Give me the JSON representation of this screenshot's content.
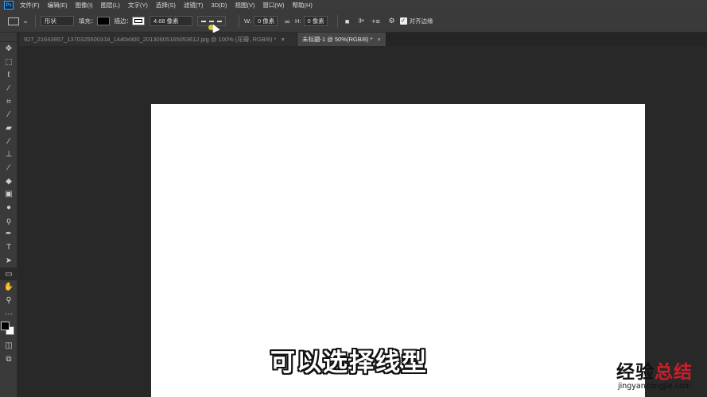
{
  "app": {
    "logo": "Ps"
  },
  "menu": [
    "文件(F)",
    "编辑(E)",
    "图像(I)",
    "图层(L)",
    "文字(Y)",
    "选择(S)",
    "滤镜(T)",
    "3D(D)",
    "视图(V)",
    "窗口(W)",
    "帮助(H)"
  ],
  "options": {
    "mode_value": "形状",
    "fill_label": "填充：",
    "stroke_label": "描边：",
    "stroke_width": "4.68 像素",
    "w_label": "W:",
    "w_value": "0 像素",
    "h_label": "H:",
    "h_value": "0 像素",
    "align_edges_label": "对齐边缘"
  },
  "tabs": [
    {
      "label": "927_21643957_1370325500318_1440x900_20130605165053612.jpg @ 100% (花瓣, RGB/8) *",
      "close": "×"
    },
    {
      "label": "未标题-1 @ 50%(RGB/8) *",
      "close": "×"
    }
  ],
  "tools": [
    "move-icon",
    "marquee-icon",
    "lasso-icon",
    "quick-select-icon",
    "crop-icon",
    "eyedropper-icon",
    "healing-icon",
    "brush-icon",
    "stamp-icon",
    "history-brush-icon",
    "eraser-icon",
    "gradient-icon",
    "blur-icon",
    "dodge-icon",
    "pen-icon",
    "type-icon",
    "path-select-icon",
    "rectangle-icon",
    "hand-icon",
    "zoom-icon",
    "more-icon"
  ],
  "colors": {
    "foreground": "#000000",
    "background": "#ffffff",
    "canvas": "#ffffff",
    "workspace": "#282828"
  },
  "subtitle": "可以选择线型",
  "watermark": {
    "title_part1": "经验",
    "title_part2": "总结",
    "url": "jingyanzongjie.com"
  }
}
